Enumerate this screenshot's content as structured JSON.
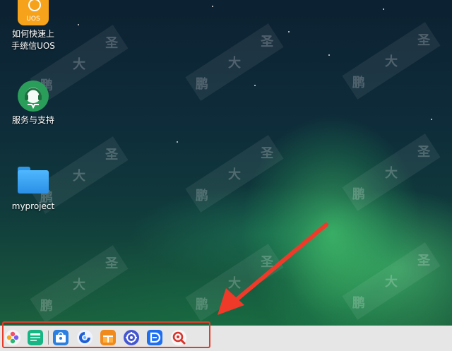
{
  "desktop": {
    "icons": [
      {
        "label_line1": "如何快速上",
        "label_line2": "手统信UOS",
        "badge": "UOS",
        "icon": "lightbulb-icon"
      },
      {
        "label_line1": "服务与支持",
        "icon": "headset-icon"
      },
      {
        "label_line1": "myproject",
        "icon": "folder-icon"
      }
    ],
    "watermark_chars": [
      "鹏",
      "大",
      "圣"
    ]
  },
  "dock": {
    "items": [
      {
        "name": "launcher",
        "icon": "launcher-icon",
        "color": "#8a5cd6"
      },
      {
        "name": "file-manager",
        "icon": "window-manager-icon",
        "color": "#17b584"
      },
      {
        "name": "app-store",
        "icon": "app-store-icon",
        "color": "#2b7fe0"
      },
      {
        "name": "browser",
        "icon": "browser-icon",
        "color": "#1f5fd6"
      },
      {
        "name": "gift-app",
        "icon": "gift-icon",
        "color": "#f08a1d"
      },
      {
        "name": "settings",
        "icon": "gear-icon",
        "color": "#4456d1"
      },
      {
        "name": "docs-app",
        "icon": "document-icon",
        "color": "#1e6ff0"
      },
      {
        "name": "search-app",
        "icon": "magnifier-icon",
        "color": "#d9332b"
      }
    ],
    "highlight_color": "#e53b2a"
  }
}
